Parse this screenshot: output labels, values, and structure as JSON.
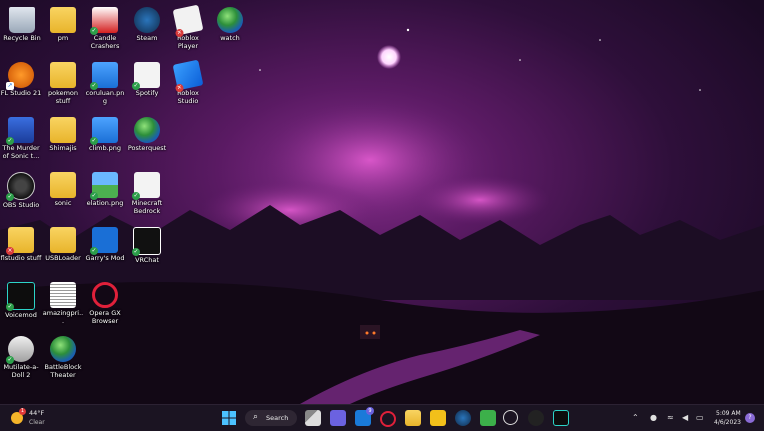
{
  "desktop": {
    "icons": [
      {
        "label": "Recycle Bin",
        "icon": "recycle-bin-icon"
      },
      {
        "label": "pm",
        "icon": "folder-icon"
      },
      {
        "label": "Candle Crashers",
        "icon": "candle-crashers-icon"
      },
      {
        "label": "Steam",
        "icon": "steam-icon"
      },
      {
        "label": "Roblox Player",
        "icon": "roblox-icon"
      },
      {
        "label": "watch",
        "icon": "globe-icon"
      },
      {
        "label": "FL Studio 21",
        "icon": "fl-studio-icon"
      },
      {
        "label": "pokemon stuff",
        "icon": "folder-icon"
      },
      {
        "label": "coruluan.png",
        "icon": "image-file-icon"
      },
      {
        "label": "Spotify",
        "icon": "file-icon"
      },
      {
        "label": "Roblox Studio",
        "icon": "roblox-studio-icon"
      },
      {
        "label": "The Murder of Sonic t...",
        "icon": "sonic-icon"
      },
      {
        "label": "Shimajis",
        "icon": "folder-icon"
      },
      {
        "label": "climb.png",
        "icon": "image-file-icon"
      },
      {
        "label": "Posterquest",
        "icon": "globe-icon"
      },
      {
        "label": "OBS Studio",
        "icon": "obs-icon"
      },
      {
        "label": "sonic",
        "icon": "folder-icon"
      },
      {
        "label": "elation.png",
        "icon": "image-file-icon"
      },
      {
        "label": "Minecraft Bedrock",
        "icon": "file-icon"
      },
      {
        "label": "flstudio stuff",
        "icon": "folder-icon"
      },
      {
        "label": "USBLoader",
        "icon": "folder-icon"
      },
      {
        "label": "Garry's Mod",
        "icon": "garrys-mod-icon"
      },
      {
        "label": "VRChat",
        "icon": "vrchat-icon"
      },
      {
        "label": "Voicemod",
        "icon": "voicemod-icon"
      },
      {
        "label": "amazingpri...",
        "icon": "document-icon"
      },
      {
        "label": "Opera GX Browser",
        "icon": "opera-gx-icon"
      },
      {
        "label": "Mutilate-a-Doll 2",
        "icon": "ragdoll-icon"
      },
      {
        "label": "BattleBlock Theater",
        "icon": "globe-icon"
      }
    ]
  },
  "taskbar": {
    "weather": {
      "temp": "44°F",
      "condition": "Clear",
      "alert": "1"
    },
    "search_label": "Search",
    "mail_badge": "9",
    "apps": [
      "start-icon",
      "search-icon",
      "task-view-icon",
      "chat-icon",
      "mail-icon",
      "opera-gx-icon",
      "file-explorer-icon",
      "calendar-icon",
      "steam-icon",
      "gamepad-icon",
      "media-player-icon",
      "obs-icon",
      "voicemod-icon"
    ],
    "clock": {
      "time": "5:09 AM",
      "date": "4/6/2023"
    },
    "colors": {
      "taskbar_bg": "#1b1422",
      "accent": "#4cc2ff"
    }
  }
}
